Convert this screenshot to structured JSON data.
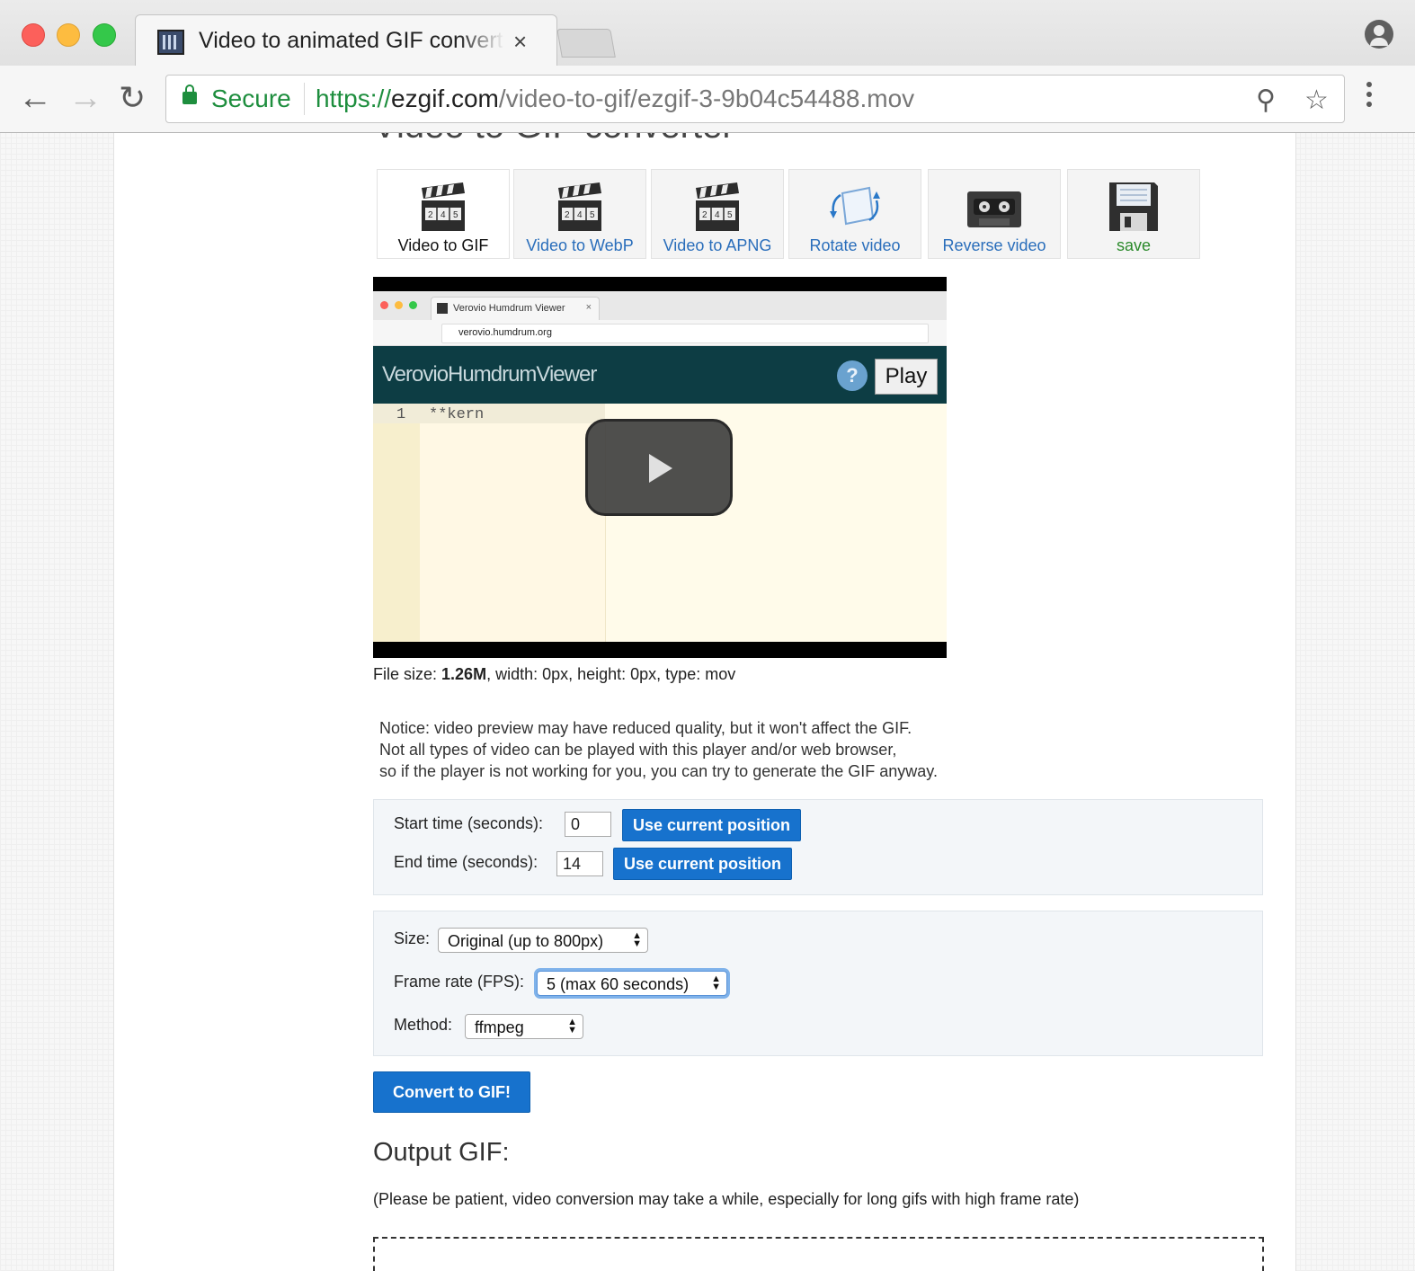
{
  "browser": {
    "tab_title": "Video to animated GIF converter",
    "tab_close": "×",
    "secure_label": "Secure",
    "url_scheme": "https://",
    "url_host": "ezgif.com",
    "url_path": "/video-to-gif/ezgif-3-9b04c54488.mov"
  },
  "page": {
    "heading": "Video to GIF converter",
    "tools": [
      {
        "label": "Video to GIF",
        "icon": "clapperboard-icon",
        "active": true
      },
      {
        "label": "Video to WebP",
        "icon": "clapperboard-icon"
      },
      {
        "label": "Video to APNG",
        "icon": "clapperboard-icon"
      },
      {
        "label": "Rotate video",
        "icon": "rotate-icon"
      },
      {
        "label": "Reverse video",
        "icon": "cassette-icon"
      },
      {
        "label": "save",
        "icon": "floppy-disk-icon"
      }
    ],
    "video_preview": {
      "tab_title": "Verovio Humdrum Viewer",
      "url": "verovio.humdrum.org",
      "app_title": "VerovioHumdrumViewer",
      "help": "?",
      "play": "Play",
      "line_number": "1",
      "code": "**kern"
    },
    "fileinfo": {
      "prefix": "File size: ",
      "size": "1.26M",
      "rest": ", width: 0px, height: 0px, type: mov"
    },
    "notice": {
      "line1": "Notice: video preview may have reduced quality, but it won't affect the GIF.",
      "line2": "Not all types of video can be played with this player and/or web browser,",
      "line3": "so if the player is not working for you, you can try to generate the GIF anyway."
    },
    "times": {
      "start_label": "Start time (seconds):",
      "start_value": "0",
      "end_label": "End time (seconds):",
      "end_value": "14",
      "use_current": "Use current position"
    },
    "options": {
      "size_label": "Size:",
      "size_value": "Original (up to 800px)",
      "fps_label": "Frame rate (FPS):",
      "fps_value": "5 (max 60 seconds)",
      "method_label": "Method:",
      "method_value": "ffmpeg"
    },
    "convert_button": "Convert to GIF!",
    "output_heading": "Output GIF:",
    "patience_text": "(Please be patient, video conversion may take a while, especially for long gifs with high frame rate)"
  },
  "colors": {
    "link_blue": "#2a6ebb",
    "button_blue": "#1772cd",
    "secure_green": "#1e8e3e",
    "save_green": "#2b8a2b"
  }
}
